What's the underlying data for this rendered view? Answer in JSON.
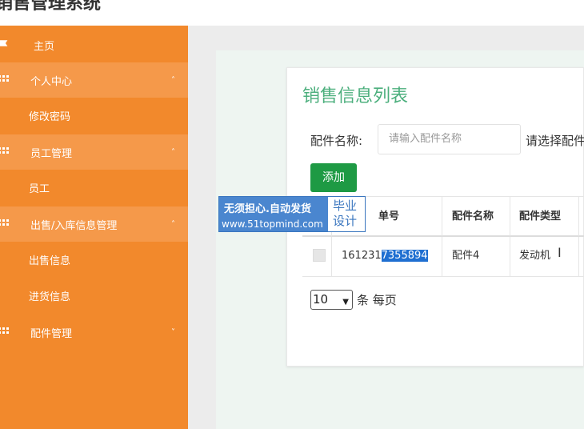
{
  "topbar": {
    "title": "销售管理系统"
  },
  "sidebar": {
    "items": [
      {
        "label": "主页",
        "type": "link",
        "icon": "flag-icon"
      },
      {
        "label": "个人中心",
        "type": "group",
        "icon": "grid-icon",
        "chevron": "˄"
      },
      {
        "label": "修改密码",
        "type": "sub"
      },
      {
        "label": "员工管理",
        "type": "group",
        "icon": "grid-icon",
        "chevron": "˄"
      },
      {
        "label": "员工",
        "type": "sub"
      },
      {
        "label": "出售/入库信息管理",
        "type": "group",
        "icon": "grid-icon",
        "chevron": "˄"
      },
      {
        "label": "出售信息",
        "type": "sub"
      },
      {
        "label": "进货信息",
        "type": "sub"
      },
      {
        "label": "配件管理",
        "type": "group",
        "icon": "grid-icon",
        "chevron": "˅"
      }
    ]
  },
  "main": {
    "title": "销售信息列表",
    "filter": {
      "label": "配件名称:",
      "placeholder": "请输入配件名称",
      "select_label": "请选择配件"
    },
    "add_label": "添加",
    "table": {
      "headers": [
        "",
        "单号",
        "配件名称",
        "配件类型"
      ],
      "rows": [
        {
          "order_prefix": "161231",
          "order_selected": "7355894",
          "part_name": "配件4",
          "part_type": "发动机"
        }
      ]
    },
    "pager": {
      "page_size": "10",
      "suffix": "条 每页"
    }
  },
  "watermark": {
    "line1": "无须担心.自动发货",
    "line2": "www.51topmind.com",
    "badge1": "毕业",
    "badge2": "设计"
  },
  "colors": {
    "sidebar": "#f2892c",
    "sidebar_group": "#f5994a",
    "title": "#4caf7d",
    "add_button": "#1e9a44"
  }
}
